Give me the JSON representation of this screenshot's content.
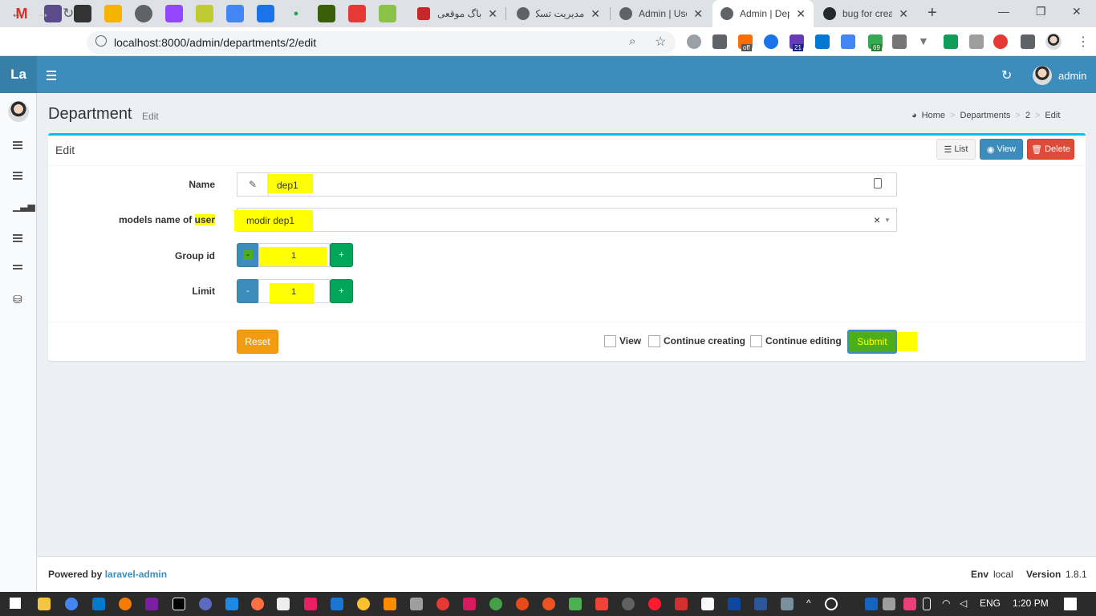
{
  "browser": {
    "tabs": [
      {
        "title": "باگ موقعی",
        "active": false
      },
      {
        "title": "مدیریت تسک",
        "active": false
      },
      {
        "title": "Admin | Use",
        "active": false
      },
      {
        "title": "Admin | Dep",
        "active": true
      },
      {
        "title": "bug for crea",
        "active": false
      }
    ],
    "new_tab": "+",
    "url": "localhost:8000/admin/departments/2/edit",
    "ext_badges": {
      "off": "off",
      "b21": "21",
      "b69": "69"
    }
  },
  "app": {
    "logo": "La",
    "user_name": "admin"
  },
  "page": {
    "title": "Department",
    "subtitle": "Edit",
    "breadcrumb": [
      "Home",
      "Departments",
      "2",
      "Edit"
    ]
  },
  "box": {
    "title": "Edit",
    "list_label": "List",
    "view_label": "View",
    "delete_label": "Delete"
  },
  "form": {
    "name_label": "Name",
    "name_value": "dep1",
    "user_label_prefix": "models name of ",
    "user_label_highlight": "user",
    "user_value": "modir dep1",
    "group_label": "Group id",
    "group_value": "1",
    "limit_label": "Limit",
    "limit_value": "1",
    "minus": "-",
    "plus": "+",
    "clear": "×",
    "reset_label": "Reset",
    "view_check_label": "View",
    "continue_creating_label": "Continue creating",
    "continue_editing_label": "Continue editing",
    "submit_label": "Submit"
  },
  "footer": {
    "powered_by": "Powered by ",
    "powered_link": "laravel-admin",
    "env_label": "Env",
    "env_value": "local",
    "version_label": "Version",
    "version_value": "1.8.1"
  },
  "taskbar": {
    "lang": "ENG",
    "time": "1:20 PM"
  },
  "colors": {
    "header": "#3c8dbc",
    "highlight": "#ffff00",
    "box_top": "#00c0ef"
  }
}
